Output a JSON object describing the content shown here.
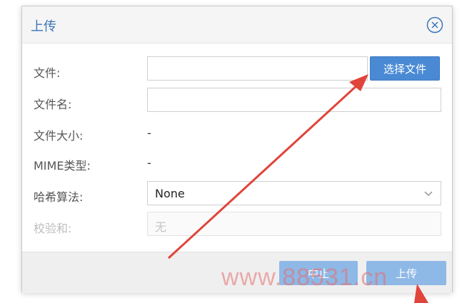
{
  "dialog": {
    "title": "上传",
    "close_icon": "close-icon"
  },
  "form": {
    "file": {
      "label": "文件:",
      "value": "",
      "button": "选择文件"
    },
    "filename": {
      "label": "文件名:",
      "value": ""
    },
    "filesize": {
      "label": "文件大小:",
      "value": "-"
    },
    "mime": {
      "label": "MIME类型:",
      "value": "-"
    },
    "hash": {
      "label": "哈希算法:",
      "selected": "None"
    },
    "checksum": {
      "label": "校验和:",
      "value": "无"
    }
  },
  "footer": {
    "abort_label": "中止",
    "upload_label": "上传"
  },
  "watermark": "www.88531.cn",
  "colors": {
    "accent": "#3a76b8",
    "primary_button": "#4a8ad4",
    "disabled_button": "#8eb8e6",
    "annotation_arrow": "#e0443a"
  }
}
